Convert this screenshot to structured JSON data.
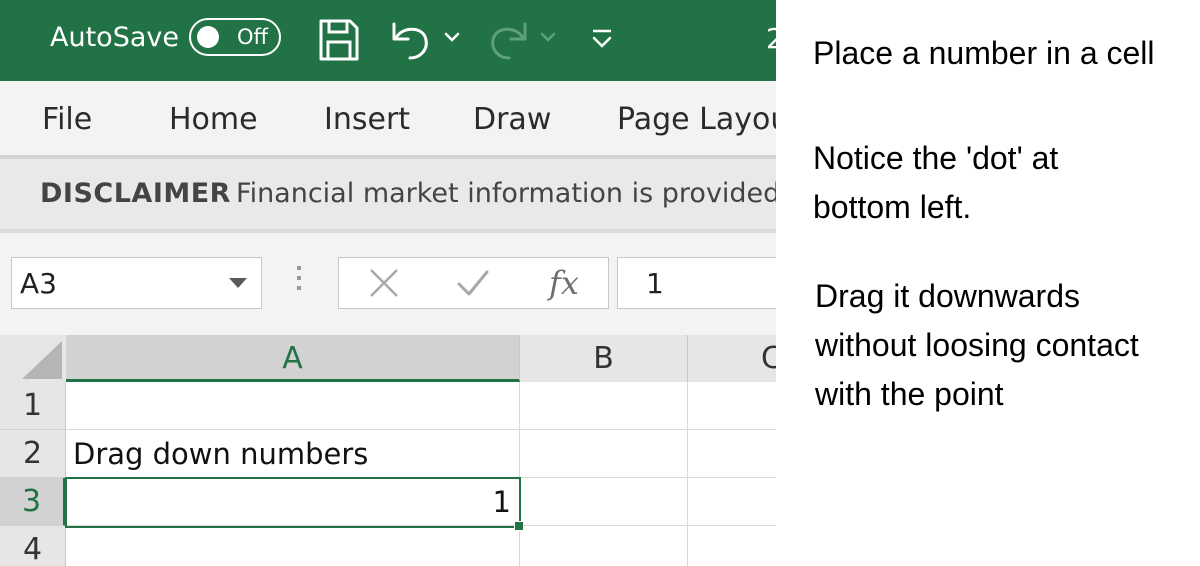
{
  "colors": {
    "brand": "#217346",
    "ribbon_bg": "#f3f3f3",
    "header_bg": "#e6e6e6",
    "selected_header_bg": "#d2d2d2"
  },
  "titlebar": {
    "autosave_label": "AutoSave",
    "autosave_state": "Off",
    "title_fragment": "2",
    "icons": [
      "save-icon",
      "undo-icon",
      "undo-dropdown-icon",
      "redo-icon",
      "redo-dropdown-icon",
      "customize-quick-access-icon"
    ]
  },
  "ribbon": {
    "tabs": [
      "File",
      "Home",
      "Insert",
      "Draw",
      "Page Layou"
    ]
  },
  "message_bar": {
    "title": "DISCLAIMER",
    "text": "Financial market information is provided"
  },
  "formula_bar": {
    "name_box": "A3",
    "cancel_icon": "cancel-icon",
    "enter_icon": "enter-icon",
    "fx_label": "fx",
    "value": "1"
  },
  "grid": {
    "columns": [
      "A",
      "B",
      "C"
    ],
    "selected_column": "A",
    "rows": [
      "1",
      "2",
      "3",
      "4"
    ],
    "selected_row": "3",
    "cells": {
      "A2": "Drag down numbers",
      "A3": "1"
    },
    "active_cell": "A3"
  },
  "instructions": [
    "Place a number in a cell",
    "Notice the 'dot' at\nbottom left.",
    "Drag it downwards\nwithout loosing contact\nwith the point"
  ]
}
